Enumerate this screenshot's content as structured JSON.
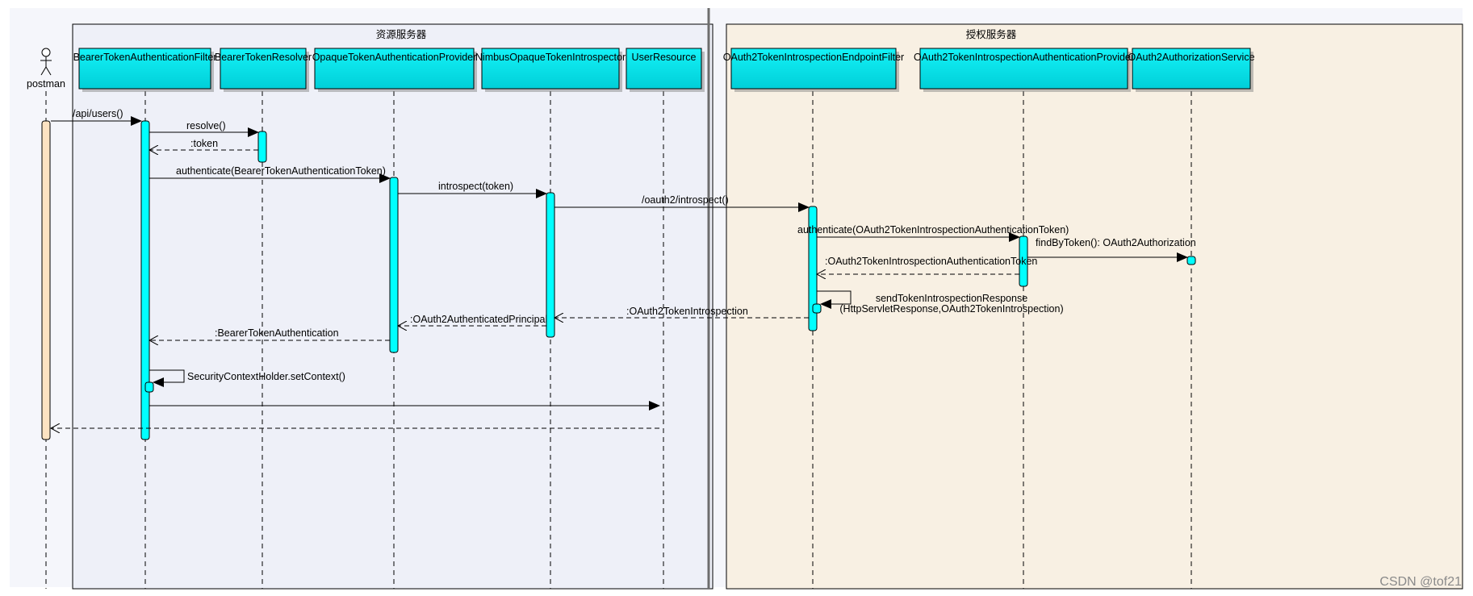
{
  "title": "",
  "frames": {
    "resource_server": {
      "label": "资源服务器"
    },
    "auth_server": {
      "label": "授权服务器"
    }
  },
  "actor": {
    "label": "postman"
  },
  "participants": [
    {
      "id": "filter",
      "label": "BearerTokenAuthenticationFilter"
    },
    {
      "id": "resolver",
      "label": "BearerTokenResolver"
    },
    {
      "id": "provider",
      "label": "OpaqueTokenAuthenticationProvider"
    },
    {
      "id": "introspector",
      "label": "NimbusOpaqueTokenIntrospector"
    },
    {
      "id": "userres",
      "label": "UserResource"
    },
    {
      "id": "endpoint",
      "label": "OAuth2TokenIntrospectionEndpointFilter"
    },
    {
      "id": "authprov",
      "label": "OAuth2TokenIntrospectionAuthenticationProvider"
    },
    {
      "id": "authsvc",
      "label": "OAuth2AuthorizationService"
    }
  ],
  "messages": [
    {
      "from": "actor",
      "to": "filter",
      "label": "/api/users()",
      "kind": "sync"
    },
    {
      "from": "filter",
      "to": "resolver",
      "label": "resolve()",
      "kind": "sync"
    },
    {
      "from": "resolver",
      "to": "filter",
      "label": ":token",
      "kind": "return"
    },
    {
      "from": "filter",
      "to": "provider",
      "label": "authenticate(BearerTokenAuthenticationToken)",
      "kind": "sync"
    },
    {
      "from": "provider",
      "to": "introspector",
      "label": "introspect(token)",
      "kind": "sync"
    },
    {
      "from": "introspector",
      "to": "endpoint",
      "label": "/oauth2/introspect()",
      "kind": "sync"
    },
    {
      "from": "endpoint",
      "to": "authprov",
      "label": "authenticate(OAuth2TokenIntrospectionAuthenticationToken)",
      "kind": "sync"
    },
    {
      "from": "authprov",
      "to": "authsvc",
      "label": "findByToken(): OAuth2Authorization",
      "kind": "sync"
    },
    {
      "from": "authprov",
      "to": "endpoint",
      "label": ":OAuth2TokenIntrospectionAuthenticationToken",
      "kind": "return"
    },
    {
      "from": "endpoint",
      "to": "endpoint",
      "label": "sendTokenIntrospectionResponse",
      "label2": "(HttpServletResponse,OAuth2TokenIntrospection)",
      "kind": "self"
    },
    {
      "from": "endpoint",
      "to": "introspector",
      "label": ":OAuth2TokenIntrospection",
      "kind": "return"
    },
    {
      "from": "introspector",
      "to": "provider",
      "label": ":OAuth2AuthenticatedPrincipal",
      "kind": "return"
    },
    {
      "from": "provider",
      "to": "filter",
      "label": ":BearerTokenAuthentication",
      "kind": "return"
    },
    {
      "from": "filter",
      "to": "filter",
      "label": "SecurityContextHolder.setContext()",
      "kind": "self"
    },
    {
      "from": "filter",
      "to": "userres",
      "label": "",
      "kind": "sync"
    },
    {
      "from": "userres",
      "to": "actor",
      "label": "",
      "kind": "return"
    }
  ],
  "colors": {
    "participant_fill": "#00e5ee",
    "activation_fill": "#00ffff",
    "actor_bar_fill": "#fde3c2",
    "resource_frame_fill": "#eef0f8",
    "auth_frame_fill": "#f8f0e3",
    "line": "#000000"
  },
  "watermark": "CSDN @tof21"
}
